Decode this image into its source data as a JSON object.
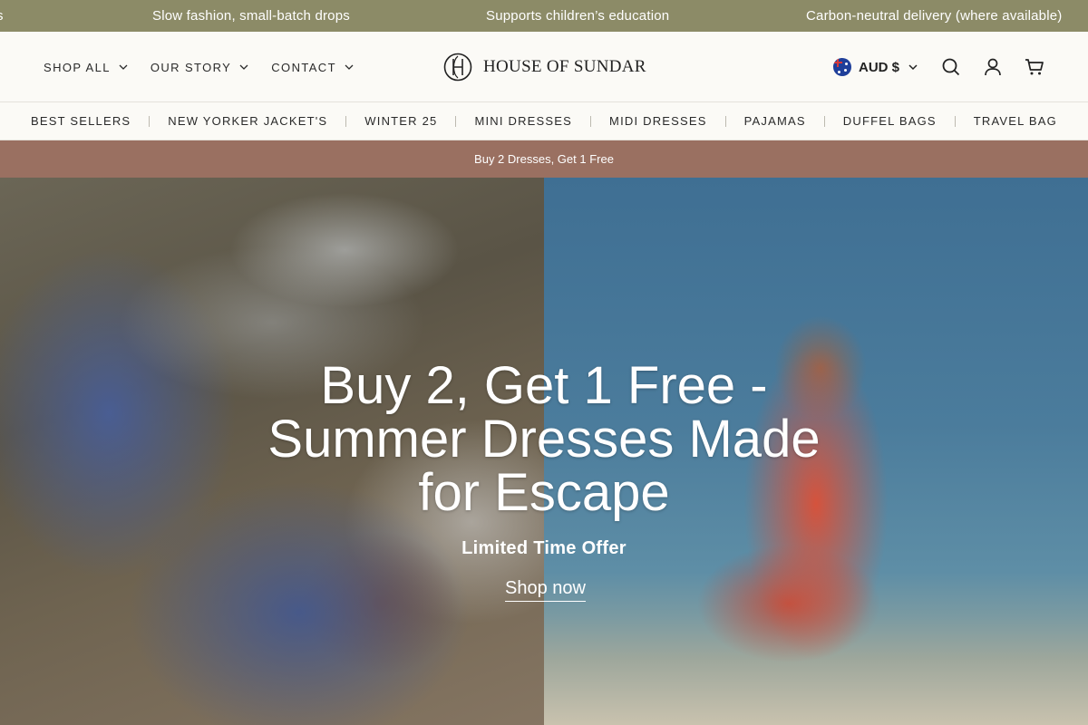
{
  "announcement": {
    "items": [
      "s",
      "Slow fashion, small-batch drops",
      "Supports children’s education",
      "Carbon-neutral delivery (where available)"
    ]
  },
  "header": {
    "nav": [
      "SHOP ALL",
      "OUR STORY",
      "CONTACT"
    ],
    "logo_text": "HOUSE OF SUNDAR",
    "currency": "AUD $",
    "icons": [
      "search-icon",
      "account-icon",
      "cart-icon"
    ]
  },
  "categories": [
    "BEST SELLERS",
    "NEW YORKER JACKET'S",
    "WINTER 25",
    "MINI DRESSES",
    "MIDI DRESSES",
    "PAJAMAS",
    "DUFFEL BAGS",
    "TRAVEL BAG"
  ],
  "promo": {
    "text": "Buy 2 Dresses, Get 1 Free"
  },
  "hero": {
    "title": "Buy 2, Get 1 Free - Summer Dresses Made for Escape",
    "subtitle": "Limited Time Offer",
    "cta": "Shop now"
  },
  "colors": {
    "announcement_bg": "#8c8b67",
    "promo_bg": "#9a7061",
    "header_bg": "#fbfaf6"
  }
}
